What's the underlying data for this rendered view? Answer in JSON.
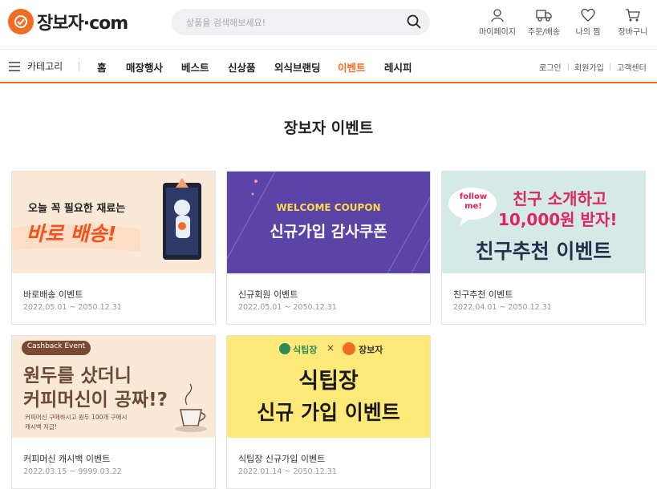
{
  "header": {
    "logo_text": "장보자·com",
    "search_placeholder": "상품을 검색해보세요!",
    "icons": {
      "mypage": "마이페이지",
      "orders": "주문/배송",
      "wishlist": "나의 찜",
      "cart": "장바구니"
    }
  },
  "nav": {
    "category_label": "카테고리",
    "items": [
      "홈",
      "매장행사",
      "베스트",
      "신상품",
      "외식브랜딩",
      "이벤트",
      "레시피"
    ],
    "active": "이벤트",
    "utility": [
      "로그인",
      "회원가입",
      "고객센터"
    ]
  },
  "page": {
    "title": "장보자 이벤트"
  },
  "events": [
    {
      "title": "바로배송 이벤트",
      "date": "2022.05.01 ~ 2050.12.31",
      "banner": {
        "line1": "오늘 꼭 필요한 재료는",
        "line2": "바로 배송!"
      }
    },
    {
      "title": "신규회원 이벤트",
      "date": "2022.05.01 ~ 2050.12.31",
      "banner": {
        "line1": "WELCOME COUPON",
        "line2": "신규가입 감사쿠폰"
      }
    },
    {
      "title": "친구추천 이벤트",
      "date": "2022.04.01 ~ 2050.12.31",
      "banner": {
        "bubble": "follow me!",
        "line1": "친구 소개하고",
        "line2": "10,000원 받자!",
        "line3": "친구추천 이벤트"
      }
    },
    {
      "title": "커피머신 캐시백 이벤트",
      "date": "2022.03.15 ~ 9999.03.22",
      "banner": {
        "tag": "Cashback Event",
        "line1": "원두를 샀더니",
        "line2": "커피머신이 공짜!?",
        "line3": "커피머신 구매하시고 원두 100개 구매시",
        "line4": "캐시백 지급!"
      }
    },
    {
      "title": "식팁장 신규가입 이벤트",
      "date": "2022.01.14 ~ 2050.12.31",
      "banner": {
        "brand1": "식팁장",
        "x": "×",
        "brand2": "장보자",
        "line1": "식팁장",
        "line2": "신규 가입 이벤트"
      }
    }
  ],
  "colors": {
    "accent": "#f26d21",
    "purple": "#5a44a6",
    "mint": "#d3eae6",
    "peach": "#fbe9d8",
    "yellow": "#ffe978"
  }
}
